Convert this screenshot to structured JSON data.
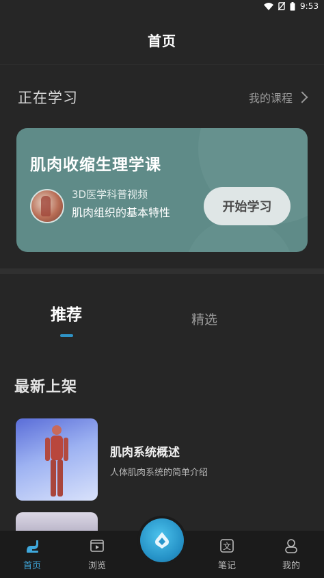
{
  "status": {
    "time": "9:53"
  },
  "header": {
    "title": "首页"
  },
  "learning": {
    "title": "正在学习",
    "my_courses_label": "我的课程",
    "course": {
      "title": "肌肉收缩生理学课",
      "subtitle": "3D医学科普视频",
      "lesson": "肌肉组织的基本特性",
      "start_label": "开始学习"
    }
  },
  "tabs": [
    {
      "label": "推荐",
      "active": true
    },
    {
      "label": "精选",
      "active": false
    }
  ],
  "section": {
    "title": "最新上架"
  },
  "videos": [
    {
      "title": "肌肉系统概述",
      "desc": "人体肌肉系统的简单介绍"
    }
  ],
  "bottom_nav": [
    {
      "label": "首页",
      "icon": "home-icon",
      "active": true
    },
    {
      "label": "浏览",
      "icon": "browse-icon",
      "active": false
    },
    {
      "label": "",
      "icon": "center-app-icon",
      "active": false
    },
    {
      "label": "笔记",
      "icon": "notes-icon",
      "active": false
    },
    {
      "label": "我的",
      "icon": "profile-icon",
      "active": false
    }
  ],
  "colors": {
    "accent": "#2f93c6",
    "card": "#5f8b88",
    "background": "#262626"
  }
}
